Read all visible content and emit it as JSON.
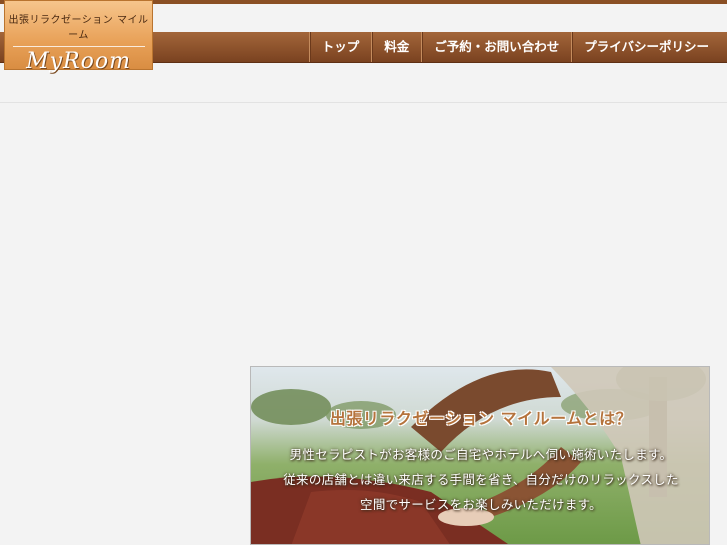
{
  "logo": {
    "subtitle": "出張リラクゼーション マイルーム",
    "name": "MyRoom"
  },
  "nav": {
    "items": [
      {
        "label": "トップ"
      },
      {
        "label": "料金"
      },
      {
        "label": "ご予約・お問い合わせ"
      },
      {
        "label": "プライバシーポリシー"
      }
    ]
  },
  "hero": {
    "title": "出張リラクゼーション マイルームとは？",
    "lines": [
      "男性セラピストがお客様のご自宅やホテルへ伺い施術いたします。",
      "従来の店舗とは違い来店する手間を省き、自分だけのリラックスした",
      "空間でサービスをお楽しみいただけます。"
    ]
  },
  "colors": {
    "nav_bar": "#8a4f24",
    "logo_bg": "#e8a158",
    "page_bg": "#f3f3f3",
    "hero_title": "#b5733c"
  }
}
